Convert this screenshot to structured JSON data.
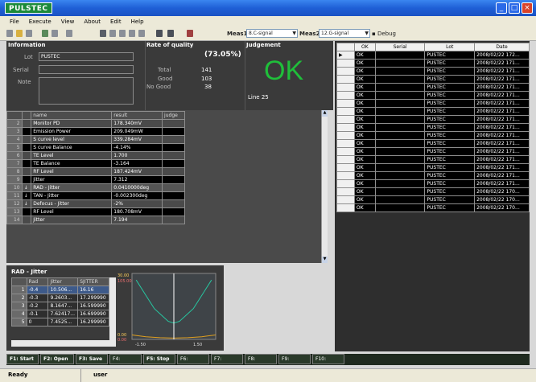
{
  "app": {
    "logo": "PULSTEC",
    "buttons": {
      "minimize": "_",
      "maximize": "□",
      "close": "×"
    }
  },
  "menu": [
    "File",
    "Execute",
    "View",
    "About",
    "Edit",
    "Help"
  ],
  "toolbar": {
    "meas1_label": "Meas1",
    "meas1_value": "8.C-signal",
    "meas2_label": "Meas2",
    "meas2_value": "12.G-signal",
    "debug_label": "Debug"
  },
  "information": {
    "title": "Information",
    "lot_label": "Lot",
    "lot_value": "PUSTEC",
    "serial_label": "Serial",
    "serial_value": "",
    "note_label": "Note",
    "note_value": ""
  },
  "quality": {
    "title": "Rate of quality",
    "rate": "(73.05%)",
    "total_label": "Total",
    "total": "141",
    "good_label": "Good",
    "good": "103",
    "nogood_label": "No Good",
    "nogood": "38"
  },
  "judgement": {
    "title": "Judgement",
    "result": "OK",
    "line": "Line 25",
    "color": "#1fbf3a"
  },
  "items_table": {
    "headers": [
      "",
      "",
      "name",
      "result",
      "judge"
    ],
    "rows": [
      {
        "no": "2",
        "mark": "",
        "name": "Monitor PD",
        "result": "178.340mV",
        "judge": ""
      },
      {
        "no": "3",
        "mark": "",
        "name": "Emission Power",
        "result": "209.049mW",
        "judge": ""
      },
      {
        "no": "4",
        "mark": "",
        "name": "S curve level",
        "result": "339.284mV",
        "judge": ""
      },
      {
        "no": "5",
        "mark": "",
        "name": "S curve Balance",
        "result": "-4.14%",
        "judge": ""
      },
      {
        "no": "6",
        "mark": "",
        "name": "TE Level",
        "result": "1.700",
        "judge": ""
      },
      {
        "no": "7",
        "mark": "",
        "name": "TE Balance",
        "result": "-3.164",
        "judge": ""
      },
      {
        "no": "8",
        "mark": "",
        "name": "RF Level",
        "result": "187.424mV",
        "judge": ""
      },
      {
        "no": "9",
        "mark": "",
        "name": "Jitter",
        "result": "7.312",
        "judge": ""
      },
      {
        "no": "10",
        "mark": "↓",
        "name": "RAD - Jitter",
        "result": "0.0410000deg",
        "judge": ""
      },
      {
        "no": "11",
        "mark": "↓",
        "name": "TAN - Jitter",
        "result": "-0.002300deg",
        "judge": ""
      },
      {
        "no": "12",
        "mark": "↓",
        "name": "Defocus - Jitter",
        "result": "-2%",
        "judge": ""
      },
      {
        "no": "13",
        "mark": "",
        "name": "RF Level",
        "result": "180.708mV",
        "judge": ""
      },
      {
        "no": "14",
        "mark": "",
        "name": "Jitter",
        "result": "7.194",
        "judge": ""
      }
    ]
  },
  "rad_jitter": {
    "title": "RAD - Jitter",
    "headers": [
      "",
      "Rad",
      "Jitter",
      "SJITTER"
    ],
    "rows": [
      {
        "no": "1",
        "rad": "-0.4",
        "jitter": "10.506...",
        "sjitter": "16.16"
      },
      {
        "no": "2",
        "rad": "-0.3",
        "jitter": "9.2603...",
        "sjitter": "17.299990"
      },
      {
        "no": "3",
        "rad": "-0.2",
        "jitter": "8.1647...",
        "sjitter": "16.599990"
      },
      {
        "no": "4",
        "rad": "-0.1",
        "jitter": "7.62417...",
        "sjitter": "16.699990"
      },
      {
        "no": "5",
        "rad": "0",
        "jitter": "7.4525...",
        "sjitter": "16.299990"
      }
    ]
  },
  "chart_data": {
    "type": "line",
    "title": "",
    "xlim": [
      -1.5,
      1.5
    ],
    "ylim": [
      0.0,
      30.0
    ],
    "x_ticks": [
      "-1.50",
      "1.50"
    ],
    "y_ticks_left": [
      "30.00",
      "0.00"
    ],
    "y_ticks_right": [
      "105.00",
      "0.00"
    ],
    "series": [
      {
        "color": "#27c6a0",
        "x": [
          -1.35,
          -1.0,
          -0.7,
          -0.4,
          -0.2,
          0.0,
          0.2,
          0.4,
          0.7,
          1.0,
          1.35
        ],
        "y": [
          27,
          20,
          14,
          10.5,
          8.2,
          7.4,
          8.2,
          10.5,
          14,
          20,
          27
        ]
      },
      {
        "color": "#e0a020",
        "x": [
          -1.5,
          -1.0,
          -0.5,
          0.0,
          0.5,
          1.0,
          1.5
        ],
        "y": [
          2.0,
          1.2,
          0.8,
          0.6,
          0.8,
          1.2,
          2.0
        ]
      }
    ],
    "marker_x": 0.0
  },
  "results_table": {
    "headers": [
      "",
      "OK",
      "Serial",
      "Lot",
      "Date"
    ],
    "rows": [
      {
        "ok": "OK",
        "serial": "",
        "lot": "PUSTEC",
        "date": "2008/02/22 172..."
      },
      {
        "ok": "OK",
        "serial": "",
        "lot": "PUSTEC",
        "date": "2008/02/22 171..."
      },
      {
        "ok": "OK",
        "serial": "",
        "lot": "PUSTEC",
        "date": "2008/02/22 171..."
      },
      {
        "ok": "OK",
        "serial": "",
        "lot": "PUSTEC",
        "date": "2008/02/22 171..."
      },
      {
        "ok": "OK",
        "serial": "",
        "lot": "PUSTEC",
        "date": "2008/02/22 171..."
      },
      {
        "ok": "OK",
        "serial": "",
        "lot": "PUSTEC",
        "date": "2008/02/22 171..."
      },
      {
        "ok": "OK",
        "serial": "",
        "lot": "PUSTEC",
        "date": "2008/02/22 171..."
      },
      {
        "ok": "OK",
        "serial": "",
        "lot": "PUSTEC",
        "date": "2008/02/22 171..."
      },
      {
        "ok": "OK",
        "serial": "",
        "lot": "PUSTEC",
        "date": "2008/02/22 171..."
      },
      {
        "ok": "OK",
        "serial": "",
        "lot": "PUSTEC",
        "date": "2008/02/22 171..."
      },
      {
        "ok": "OK",
        "serial": "",
        "lot": "PUSTEC",
        "date": "2008/02/22 171..."
      },
      {
        "ok": "OK",
        "serial": "",
        "lot": "PUSTEC",
        "date": "2008/02/22 171..."
      },
      {
        "ok": "OK",
        "serial": "",
        "lot": "PUSTEC",
        "date": "2008/02/22 171..."
      },
      {
        "ok": "OK",
        "serial": "",
        "lot": "PUSTEC",
        "date": "2008/02/22 171..."
      },
      {
        "ok": "OK",
        "serial": "",
        "lot": "PUSTEC",
        "date": "2008/02/22 171..."
      },
      {
        "ok": "OK",
        "serial": "",
        "lot": "PUSTEC",
        "date": "2008/02/22 171..."
      },
      {
        "ok": "OK",
        "serial": "",
        "lot": "PUSTEC",
        "date": "2008/02/22 171..."
      },
      {
        "ok": "OK",
        "serial": "",
        "lot": "PUSTEC",
        "date": "2008/02/22 170..."
      },
      {
        "ok": "OK",
        "serial": "",
        "lot": "PUSTEC",
        "date": "2008/02/22 170..."
      },
      {
        "ok": "OK",
        "serial": "",
        "lot": "PUSTEC",
        "date": "2008/02/22 170..."
      }
    ]
  },
  "fkeys": [
    "F1: Start",
    "F2: Open",
    "F3: Save",
    "F4:",
    "F5: Stop",
    "F6:",
    "F7:",
    "F8:",
    "F9:",
    "F10:"
  ],
  "status": {
    "state": "Ready",
    "user": "user"
  }
}
